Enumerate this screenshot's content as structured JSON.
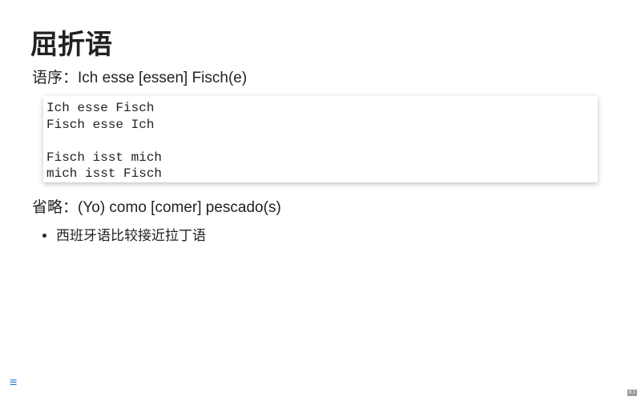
{
  "title": "屈折语",
  "word_order_line": "语序：Ich esse [essen] Fisch(e)",
  "code_block": "Ich esse Fisch\nFisch esse Ich\n\nFisch isst mich\nmich isst Fisch",
  "omission_line": "省略：(Yo) como [comer] pescado(s)",
  "bullets": [
    "西班牙语比较接近拉丁语"
  ],
  "menu_icon": "≡",
  "slide_number": "6.1"
}
